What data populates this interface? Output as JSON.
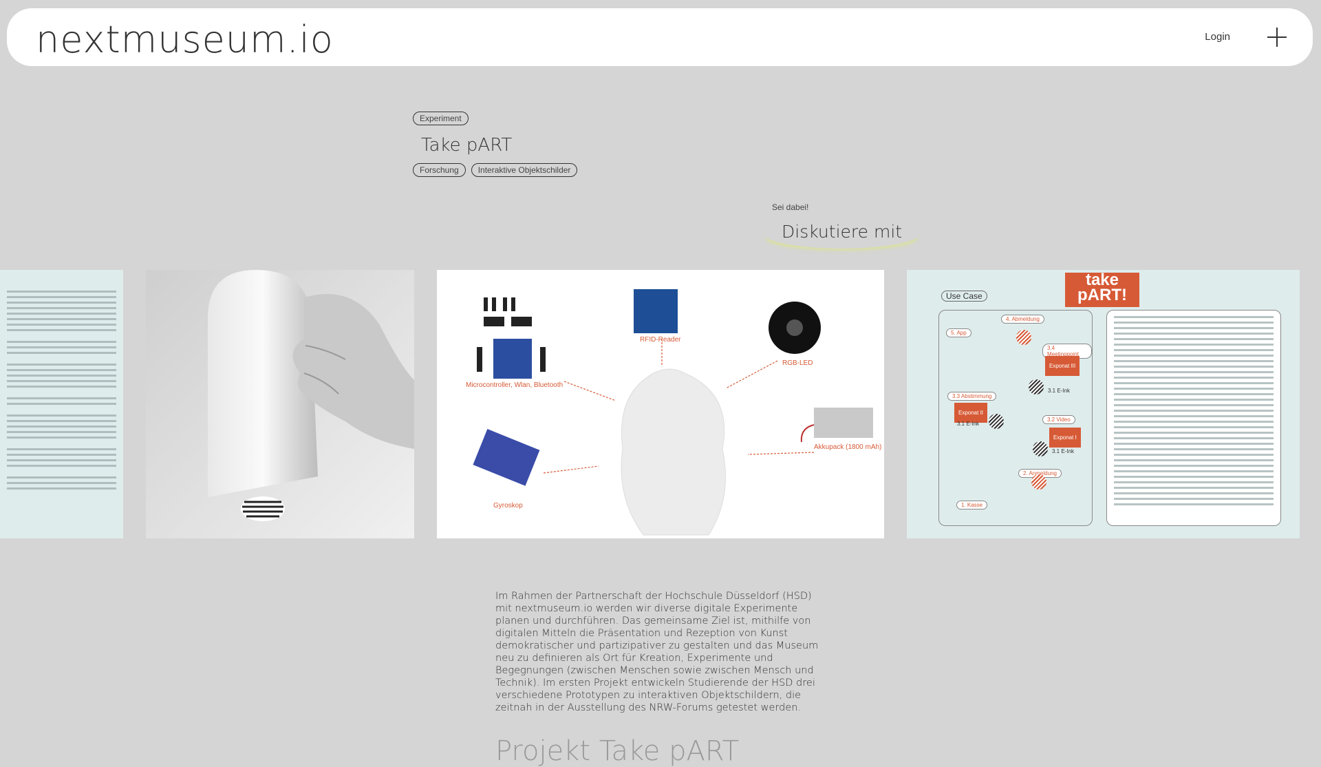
{
  "header": {
    "logo": "nextmuseum.io",
    "login_label": "Login",
    "plus_icon": "plus-icon"
  },
  "project": {
    "category_tag": "Experiment",
    "title": "Take pART",
    "tags": [
      "Forschung",
      "Interaktive Objektschilder"
    ]
  },
  "join": {
    "small": "Sei dabei!",
    "cta": "Diskutiere mit"
  },
  "gallery": {
    "components": {
      "microcontroller": "Microcontroller, Wlan, Bluetooth",
      "rfid": "RFID-Reader",
      "rgb": "RGB-LED",
      "akku": "Akkupack (1800 mAh)",
      "gyro": "Gyroskop"
    },
    "usecase": {
      "logo_line1": "take",
      "logo_line2": "pART!",
      "label": "Use Case",
      "nodes": [
        "5. App",
        "4. Abmeldung",
        "3.4 Meetingpoint",
        "3.3 Abstimmung",
        "3.2 Video",
        "2. Anmeldung",
        "1. Kasse"
      ],
      "exponate": [
        "Exponat III",
        "Exponat II",
        "Exponat I"
      ],
      "eink": "3.1 E-Ink"
    }
  },
  "description": "Im Rahmen der Partnerschaft der Hochschule Düsseldorf (HSD) mit nextmuseum.io werden wir diverse digitale Experimente planen und durchführen. Das gemeinsame Ziel ist, mithilfe von digitalen Mitteln die Präsentation und Rezeption von Kunst demokratischer und partizipativer zu gestalten und das Museum neu zu definieren als Ort für Kreation, Experimente und Begegnungen (zwischen Menschen sowie zwischen Mensch und Technik). Im ersten Projekt entwickeln Studierende der HSD drei verschiedene Prototypen zu interaktiven Objektschildern, die zeitnah in der Ausstellung des NRW-Forums getestet werden.",
  "section_heading": "Projekt Take pART"
}
